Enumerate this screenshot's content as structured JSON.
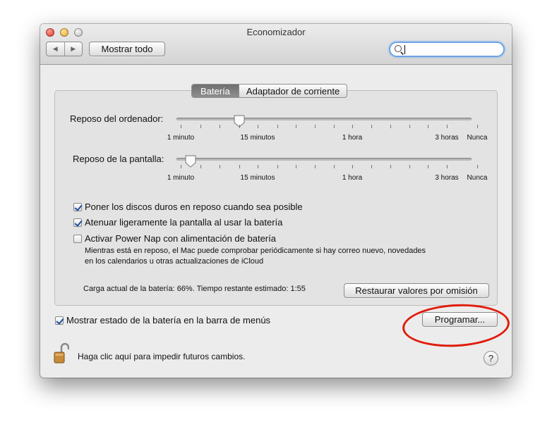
{
  "window": {
    "title": "Economizador"
  },
  "toolbar": {
    "back_icon": "chevron-left-icon",
    "forward_icon": "chevron-right-icon",
    "show_all_label": "Mostrar todo",
    "search_value": "",
    "search_placeholder": ""
  },
  "tabs": [
    {
      "label": "Batería",
      "active": true
    },
    {
      "label": "Adaptador de corriente",
      "active": false
    }
  ],
  "sliders": {
    "computer_sleep": {
      "label": "Reposo del ordenador:",
      "value": "15 minutos"
    },
    "display_sleep": {
      "label": "Reposo de la pantalla:",
      "value": "1 minuto"
    },
    "tick_labels": [
      "1 minuto",
      "15 minutos",
      "1 hora",
      "3 horas",
      "Nunca"
    ]
  },
  "checkboxes": {
    "hard_disk_sleep": {
      "label": "Poner los discos duros en reposo cuando sea posible",
      "checked": true
    },
    "dim_display": {
      "label": "Atenuar ligeramente la pantalla al usar la batería",
      "checked": true
    },
    "power_nap": {
      "label": "Activar Power Nap con alimentación de batería",
      "checked": false
    },
    "power_nap_note_line1": "Mientras está en reposo, el Mac puede comprobar periódicamente si hay correo nuevo, novedades",
    "power_nap_note_line2": "en los calendarios u otras actualizaciones de iCloud",
    "show_battery_status": {
      "label": "Mostrar estado de la batería en la barra de menús",
      "checked": true
    }
  },
  "battery": {
    "status_text": "Carga actual de la batería: 66%. Tiempo restante estimado: 1:55"
  },
  "buttons": {
    "restore_defaults": "Restaurar valores por omisión",
    "schedule": "Programar..."
  },
  "footer": {
    "lock_icon": "unlocked-padlock-icon",
    "lock_hint": "Haga clic aquí para impedir futuros cambios.",
    "help_label": "?"
  },
  "colors": {
    "highlight_ring": "#e01c0c",
    "search_focus": "#6fa3e6",
    "checkmark": "#1d4fa0"
  }
}
